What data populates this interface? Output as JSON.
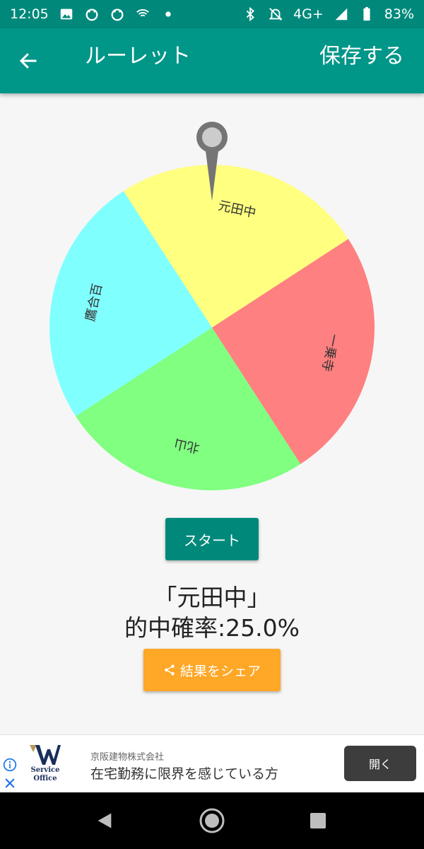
{
  "status_bar": {
    "time": "12:05",
    "network": "4G+",
    "battery": "83%",
    "left_icons": [
      "image-icon",
      "notification-icon",
      "notification-icon",
      "wifi-calling-icon",
      "dot-icon"
    ],
    "right_icons": [
      "bluetooth-icon",
      "mute-icon",
      "signal-icon",
      "battery-icon"
    ]
  },
  "app_bar": {
    "back_icon": "arrow-back-icon",
    "title": "ルーレット",
    "save_label": "保存する"
  },
  "roulette": {
    "segments": [
      {
        "label": "元田中",
        "color": "#ffff80"
      },
      {
        "label": "一乗寺",
        "color": "#ff8080"
      },
      {
        "label": "北山",
        "color": "#80ff80"
      },
      {
        "label": "鷹合百",
        "color": "#80ffff"
      }
    ],
    "pointer_color": "#757575"
  },
  "start_label": "スタート",
  "result": {
    "name": "「元田中」",
    "rate": "的中確率:25.0%"
  },
  "share": {
    "icon": "share-icon",
    "label": "結果をシェア"
  },
  "ad": {
    "logo_text_line1": "Service",
    "logo_text_line2": "Office",
    "company": "京阪建物株式会社",
    "headline": "在宅勤務に限界を感じている方",
    "open_label": "開く"
  },
  "nav": {
    "icons": [
      "nav-back-icon",
      "nav-home-icon",
      "nav-recents-icon"
    ]
  }
}
